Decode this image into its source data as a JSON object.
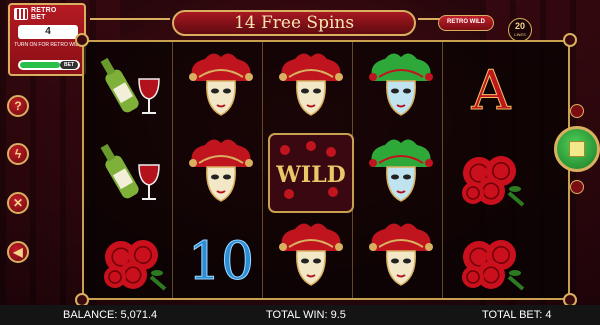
{
  "bet_panel": {
    "logo_line1": "RETRO",
    "logo_line2": "BET",
    "count": "4",
    "description": "TURN ON FOR RETRO WILD",
    "toggle_value": "BET"
  },
  "title_banner": {
    "text": "14 Free Spins"
  },
  "retro_wild": {
    "label": "RETRO WILD"
  },
  "lines": {
    "count": "20",
    "label": "LINES"
  },
  "side_buttons": [
    {
      "icon": "help-icon",
      "glyph": "?"
    },
    {
      "icon": "lightning-icon",
      "glyph": "ϟ"
    },
    {
      "icon": "tools-icon",
      "glyph": "✕"
    },
    {
      "icon": "sound-icon",
      "glyph": "◀"
    }
  ],
  "reels": {
    "columns": [
      [
        "wine",
        "wine",
        "rose"
      ],
      [
        "mask-red",
        "mask-red",
        "ten"
      ],
      [
        "mask-red",
        "wild",
        "mask-red"
      ],
      [
        "mask-green",
        "mask-green",
        "mask-red"
      ],
      [
        "ace",
        "rose",
        "rose"
      ]
    ],
    "wild_label": "WILD",
    "ten_label": "10",
    "ace_label": "A"
  },
  "colors": {
    "gold": "#d8b060",
    "crimson": "#a81822",
    "spin_green": "#2e9a38"
  },
  "bottom_bar": {
    "balance": "BALANCE: 5,071.4",
    "total_win": "TOTAL WIN: 9.5",
    "total_bet": "TOTAL BET: 4"
  }
}
